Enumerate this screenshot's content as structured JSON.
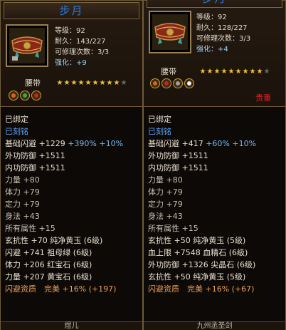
{
  "left": {
    "title": "步月",
    "info": [
      "等级：92",
      "耐久：143/227",
      "可修理次数：3/3"
    ],
    "enhance_label": "强化：",
    "enhance_value": "+9",
    "item_type": "腰带",
    "stars_lit": 9,
    "stars_total": 10,
    "gems": [
      "orange",
      "green",
      "red"
    ],
    "bound": "已绑定",
    "engraved": "已刻铭",
    "stats": [
      {
        "parts": [
          {
            "t": "基础闪避 +1229 ",
            "c": "white"
          },
          {
            "t": "+390% +10%",
            "c": "blue2"
          }
        ]
      },
      {
        "parts": [
          {
            "t": "外功防御 +1511",
            "c": "white"
          }
        ]
      },
      {
        "parts": [
          {
            "t": "内功防御 +1511",
            "c": "white"
          }
        ]
      },
      {
        "parts": [
          {
            "t": "力量 +80",
            "c": "gray"
          }
        ]
      },
      {
        "parts": [
          {
            "t": "体力 +79",
            "c": "gray"
          }
        ]
      },
      {
        "parts": [
          {
            "t": "定力 +79",
            "c": "gray"
          }
        ]
      },
      {
        "parts": [
          {
            "t": "身法 +43",
            "c": "gray"
          }
        ]
      },
      {
        "parts": [
          {
            "t": "所有属性 +15",
            "c": "gray"
          }
        ]
      },
      {
        "parts": [
          {
            "t": "玄抗性 +70 纯净黄玉 (6级)",
            "c": "white"
          }
        ]
      },
      {
        "parts": [
          {
            "t": "闪避 +741 祖母绿 (6级)",
            "c": "white"
          }
        ]
      },
      {
        "parts": [
          {
            "t": "体力 +206 红宝石 (6级)",
            "c": "white"
          }
        ]
      },
      {
        "parts": [
          {
            "t": "力量 +207 黄宝石 (6级)",
            "c": "white"
          }
        ]
      },
      {
        "parts": [
          {
            "t": "闪避资质　完美 +16% (+197)",
            "c": "orange"
          }
        ]
      }
    ],
    "footer": "煜儿"
  },
  "right": {
    "title": "步月",
    "info": [
      "等级：92",
      "耐久：128/227",
      "可修理次数：3/3"
    ],
    "enhance_label": "强化：",
    "enhance_value": "+4",
    "item_type": "腰带",
    "stars_lit": 9,
    "stars_total": 10,
    "gems": [
      "orange",
      "red",
      "gray",
      "white"
    ],
    "valuable": "贵重",
    "bound": "已绑定",
    "engraved": "已刻铭",
    "stats": [
      {
        "parts": [
          {
            "t": "基础闪避 +417 ",
            "c": "white"
          },
          {
            "t": "+60% +10%",
            "c": "blue2"
          }
        ]
      },
      {
        "parts": [
          {
            "t": "外功防御 +1511",
            "c": "white"
          }
        ]
      },
      {
        "parts": [
          {
            "t": "内功防御 +1511",
            "c": "white"
          }
        ]
      },
      {
        "parts": [
          {
            "t": "力量 +80",
            "c": "gray"
          }
        ]
      },
      {
        "parts": [
          {
            "t": "体力 +79",
            "c": "gray"
          }
        ]
      },
      {
        "parts": [
          {
            "t": "定力 +79",
            "c": "gray"
          }
        ]
      },
      {
        "parts": [
          {
            "t": "身法 +43",
            "c": "gray"
          }
        ]
      },
      {
        "parts": [
          {
            "t": "所有属性 +15",
            "c": "gray"
          }
        ]
      },
      {
        "parts": [
          {
            "t": "玄抗性 +50 纯净黄玉 (5级)",
            "c": "white"
          }
        ]
      },
      {
        "parts": [
          {
            "t": "血上限 +7548 血精石 (6级)",
            "c": "white"
          }
        ]
      },
      {
        "parts": [
          {
            "t": "外功防御 +1326 尖晶石 (6级)",
            "c": "white"
          }
        ]
      },
      {
        "parts": [
          {
            "t": "玄抗性 +50 纯净黄玉 (5级)",
            "c": "white"
          }
        ]
      },
      {
        "parts": [
          {
            "t": "闪避资质　完美 +16% (+67)",
            "c": "orange"
          }
        ]
      }
    ],
    "footer": "九州丞圣剑"
  },
  "colors": {
    "title": "#2a7ae0",
    "border": "#6e5a38",
    "valuable": "#e02020",
    "quality": "#e8a060",
    "enhance": "#9cd0f0",
    "engraved": "#5aa0f0"
  },
  "icons": {
    "item": "belt-icon",
    "star": "star-icon",
    "gem": "gem-socket-icon"
  }
}
